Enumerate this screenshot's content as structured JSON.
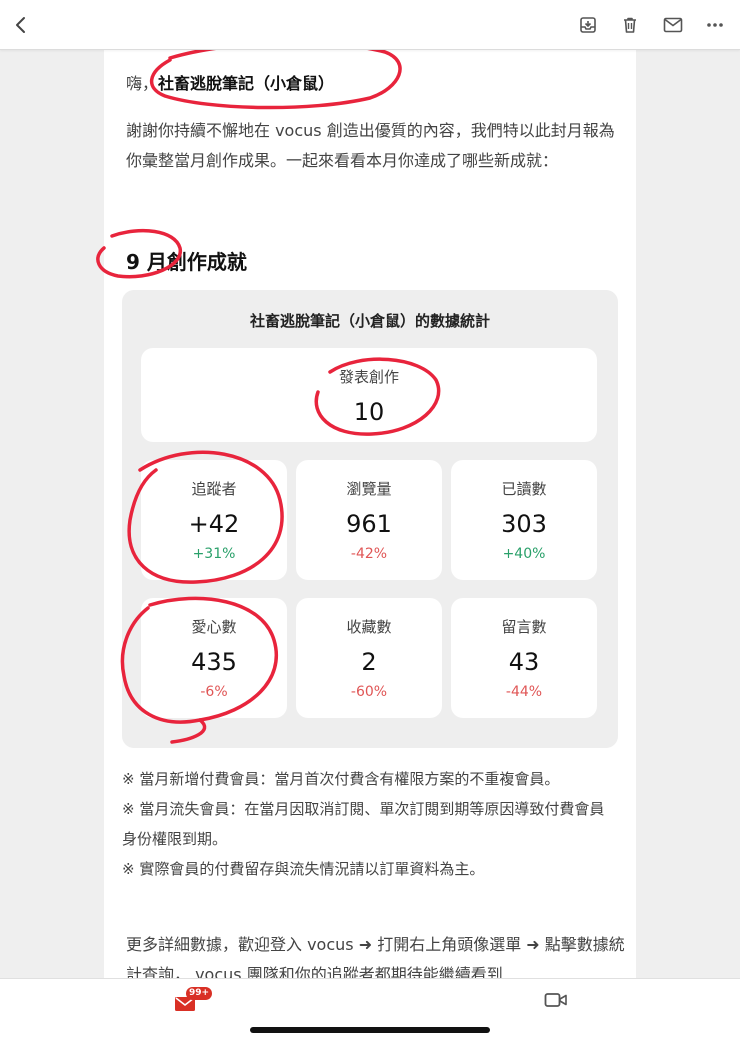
{
  "greeting": {
    "prefix": "嗨，",
    "name": "社畜逃脫筆記（小倉鼠）"
  },
  "intro_text": "謝謝你持續不懈地在 vocus 創造出優質的內容，我們特以此封月報為你彙整當月創作成果。一起來看看本月你達成了哪些新成就：",
  "month_title": "9 月創作成就",
  "stats": {
    "title": "社畜逃脫筆記（小倉鼠）的數據統計",
    "published": {
      "label": "發表創作",
      "value": "10"
    },
    "followers": {
      "label": "追蹤者",
      "value": "+42",
      "change": "+31%"
    },
    "views": {
      "label": "瀏覽量",
      "value": "961",
      "change": "-42%"
    },
    "reads": {
      "label": "已讀數",
      "value": "303",
      "change": "+40%"
    },
    "likes": {
      "label": "愛心數",
      "value": "435",
      "change": "-6%"
    },
    "saves": {
      "label": "收藏數",
      "value": "2",
      "change": "-60%"
    },
    "comments": {
      "label": "留言數",
      "value": "43",
      "change": "-44%"
    }
  },
  "notes": [
    "※ 當月新增付費會員：當月首次付費含有權限方案的不重複會員。",
    "※ 當月流失會員：在當月因取消訂閱、單次訂閱到期等原因導致付費會員身份權限到期。",
    "※ 實際會員的付費留存與流失情況請以訂單資料為主。"
  ],
  "more_text": "更多詳細數據，歡迎登入 vocus ➜ 打開右上角頭像選單 ➜ 點擊數據統計查詢， vocus 團隊和你的追蹤者都期待能繼續看到",
  "bottom": {
    "mail_badge": "99+"
  },
  "icons": {
    "back": "back-arrow-icon",
    "archive": "archive-icon",
    "delete": "trash-icon",
    "mark_unread": "mail-icon",
    "more": "more-dots-icon",
    "mail_tab": "mail-tab-icon",
    "video_tab": "video-camera-icon"
  },
  "colors": {
    "positive": "#2aa06a",
    "negative": "#e05656",
    "annotation": "#e8243c",
    "gmail_red": "#d93025"
  }
}
